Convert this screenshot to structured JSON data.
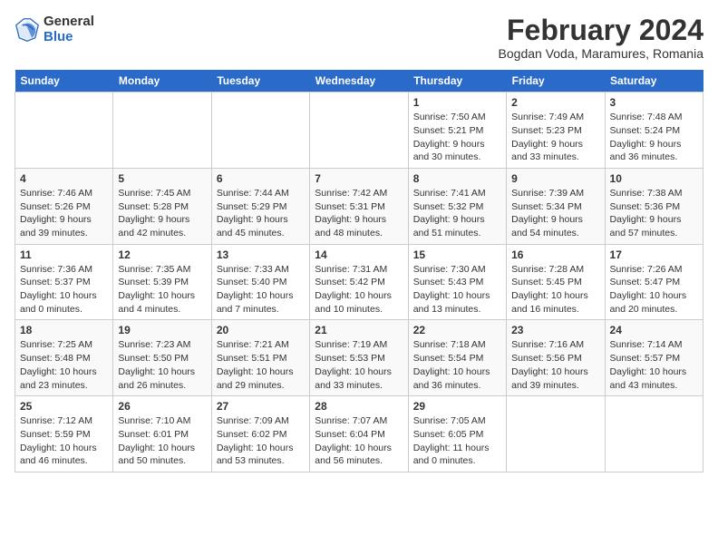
{
  "header": {
    "logo_general": "General",
    "logo_blue": "Blue",
    "main_title": "February 2024",
    "subtitle": "Bogdan Voda, Maramures, Romania"
  },
  "calendar": {
    "days_of_week": [
      "Sunday",
      "Monday",
      "Tuesday",
      "Wednesday",
      "Thursday",
      "Friday",
      "Saturday"
    ],
    "weeks": [
      {
        "days": [
          {
            "number": "",
            "info": ""
          },
          {
            "number": "",
            "info": ""
          },
          {
            "number": "",
            "info": ""
          },
          {
            "number": "",
            "info": ""
          },
          {
            "number": "1",
            "info": "Sunrise: 7:50 AM\nSunset: 5:21 PM\nDaylight: 9 hours and 30 minutes."
          },
          {
            "number": "2",
            "info": "Sunrise: 7:49 AM\nSunset: 5:23 PM\nDaylight: 9 hours and 33 minutes."
          },
          {
            "number": "3",
            "info": "Sunrise: 7:48 AM\nSunset: 5:24 PM\nDaylight: 9 hours and 36 minutes."
          }
        ]
      },
      {
        "days": [
          {
            "number": "4",
            "info": "Sunrise: 7:46 AM\nSunset: 5:26 PM\nDaylight: 9 hours and 39 minutes."
          },
          {
            "number": "5",
            "info": "Sunrise: 7:45 AM\nSunset: 5:28 PM\nDaylight: 9 hours and 42 minutes."
          },
          {
            "number": "6",
            "info": "Sunrise: 7:44 AM\nSunset: 5:29 PM\nDaylight: 9 hours and 45 minutes."
          },
          {
            "number": "7",
            "info": "Sunrise: 7:42 AM\nSunset: 5:31 PM\nDaylight: 9 hours and 48 minutes."
          },
          {
            "number": "8",
            "info": "Sunrise: 7:41 AM\nSunset: 5:32 PM\nDaylight: 9 hours and 51 minutes."
          },
          {
            "number": "9",
            "info": "Sunrise: 7:39 AM\nSunset: 5:34 PM\nDaylight: 9 hours and 54 minutes."
          },
          {
            "number": "10",
            "info": "Sunrise: 7:38 AM\nSunset: 5:36 PM\nDaylight: 9 hours and 57 minutes."
          }
        ]
      },
      {
        "days": [
          {
            "number": "11",
            "info": "Sunrise: 7:36 AM\nSunset: 5:37 PM\nDaylight: 10 hours and 0 minutes."
          },
          {
            "number": "12",
            "info": "Sunrise: 7:35 AM\nSunset: 5:39 PM\nDaylight: 10 hours and 4 minutes."
          },
          {
            "number": "13",
            "info": "Sunrise: 7:33 AM\nSunset: 5:40 PM\nDaylight: 10 hours and 7 minutes."
          },
          {
            "number": "14",
            "info": "Sunrise: 7:31 AM\nSunset: 5:42 PM\nDaylight: 10 hours and 10 minutes."
          },
          {
            "number": "15",
            "info": "Sunrise: 7:30 AM\nSunset: 5:43 PM\nDaylight: 10 hours and 13 minutes."
          },
          {
            "number": "16",
            "info": "Sunrise: 7:28 AM\nSunset: 5:45 PM\nDaylight: 10 hours and 16 minutes."
          },
          {
            "number": "17",
            "info": "Sunrise: 7:26 AM\nSunset: 5:47 PM\nDaylight: 10 hours and 20 minutes."
          }
        ]
      },
      {
        "days": [
          {
            "number": "18",
            "info": "Sunrise: 7:25 AM\nSunset: 5:48 PM\nDaylight: 10 hours and 23 minutes."
          },
          {
            "number": "19",
            "info": "Sunrise: 7:23 AM\nSunset: 5:50 PM\nDaylight: 10 hours and 26 minutes."
          },
          {
            "number": "20",
            "info": "Sunrise: 7:21 AM\nSunset: 5:51 PM\nDaylight: 10 hours and 29 minutes."
          },
          {
            "number": "21",
            "info": "Sunrise: 7:19 AM\nSunset: 5:53 PM\nDaylight: 10 hours and 33 minutes."
          },
          {
            "number": "22",
            "info": "Sunrise: 7:18 AM\nSunset: 5:54 PM\nDaylight: 10 hours and 36 minutes."
          },
          {
            "number": "23",
            "info": "Sunrise: 7:16 AM\nSunset: 5:56 PM\nDaylight: 10 hours and 39 minutes."
          },
          {
            "number": "24",
            "info": "Sunrise: 7:14 AM\nSunset: 5:57 PM\nDaylight: 10 hours and 43 minutes."
          }
        ]
      },
      {
        "days": [
          {
            "number": "25",
            "info": "Sunrise: 7:12 AM\nSunset: 5:59 PM\nDaylight: 10 hours and 46 minutes."
          },
          {
            "number": "26",
            "info": "Sunrise: 7:10 AM\nSunset: 6:01 PM\nDaylight: 10 hours and 50 minutes."
          },
          {
            "number": "27",
            "info": "Sunrise: 7:09 AM\nSunset: 6:02 PM\nDaylight: 10 hours and 53 minutes."
          },
          {
            "number": "28",
            "info": "Sunrise: 7:07 AM\nSunset: 6:04 PM\nDaylight: 10 hours and 56 minutes."
          },
          {
            "number": "29",
            "info": "Sunrise: 7:05 AM\nSunset: 6:05 PM\nDaylight: 11 hours and 0 minutes."
          },
          {
            "number": "",
            "info": ""
          },
          {
            "number": "",
            "info": ""
          }
        ]
      }
    ]
  }
}
